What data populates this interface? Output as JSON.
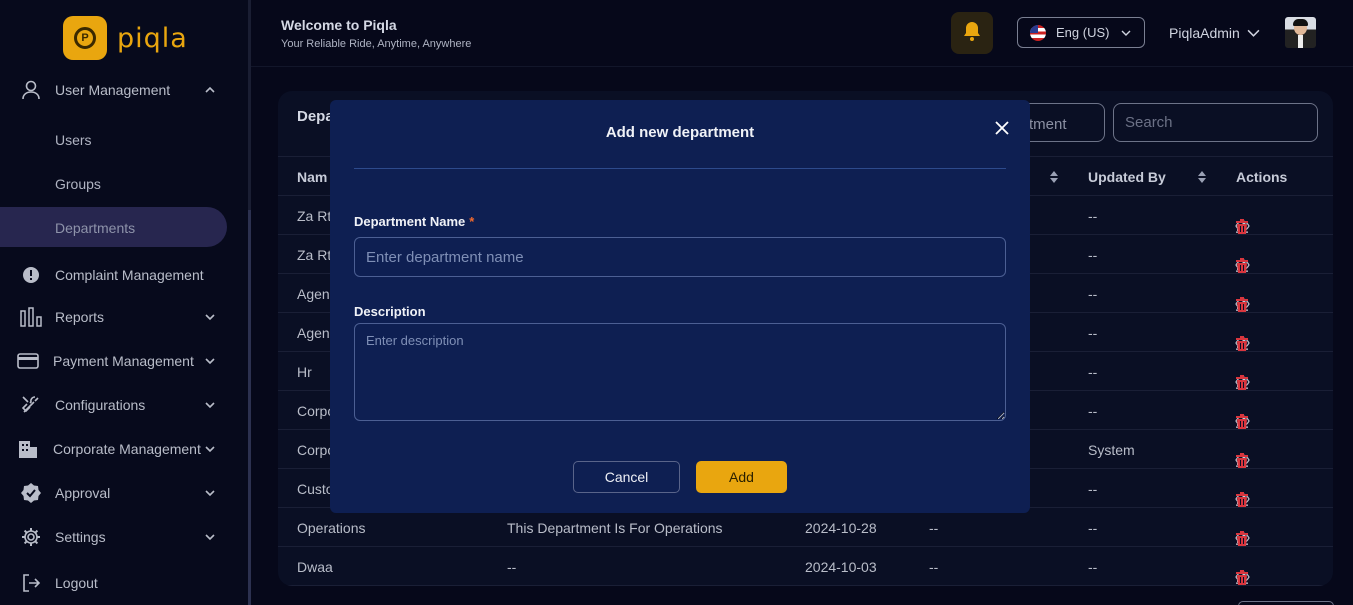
{
  "app": {
    "name": "piqla"
  },
  "sidebar": {
    "items": [
      {
        "label": "User Management",
        "icon": "user-icon"
      },
      {
        "label": "Complaint Management",
        "icon": "alert-circle-icon"
      },
      {
        "label": "Reports",
        "icon": "bar-chart-icon"
      },
      {
        "label": "Payment Management",
        "icon": "credit-card-icon"
      },
      {
        "label": "Configurations",
        "icon": "tools-icon"
      },
      {
        "label": "Corporate Management",
        "icon": "building-icon"
      },
      {
        "label": "Approval",
        "icon": "badge-check-icon"
      },
      {
        "label": "Settings",
        "icon": "gear-icon"
      },
      {
        "label": "Logout",
        "icon": "logout-icon"
      }
    ],
    "sub_items": [
      "Users",
      "Groups",
      "Departments"
    ]
  },
  "header": {
    "welcome": "Welcome to Piqla",
    "tagline": "Your Reliable Ride, Anytime, Anywhere",
    "language": "Eng (US)",
    "user": "PiqlaAdmin"
  },
  "card": {
    "title": "Depa",
    "add_button_partial": "tment",
    "search_placeholder": "Search",
    "columns": {
      "name": "Nam",
      "updated_by": "Updated By",
      "actions": "Actions"
    },
    "rows": [
      {
        "name": "Za Rt",
        "description": "",
        "created": "",
        "created_by": "",
        "updated_by": "--"
      },
      {
        "name": "Za Rt",
        "description": "",
        "created": "",
        "created_by": "",
        "updated_by": "--"
      },
      {
        "name": "Agen",
        "description": "",
        "created": "",
        "created_by": "",
        "updated_by": "--"
      },
      {
        "name": "Agen",
        "description": "",
        "created": "",
        "created_by": "",
        "updated_by": "--"
      },
      {
        "name": "Hr",
        "description": "",
        "created": "",
        "created_by": "",
        "updated_by": "--"
      },
      {
        "name": "Corpo",
        "description": "",
        "created": "",
        "created_by": "",
        "updated_by": "--"
      },
      {
        "name": "Corpo",
        "description": "",
        "created": "",
        "created_by": "",
        "updated_by": "System"
      },
      {
        "name": "Custo",
        "description": "",
        "created": "",
        "created_by": "",
        "updated_by": "--"
      },
      {
        "name": "Operations",
        "description": "This Department Is For Operations",
        "created": "2024-10-28",
        "created_by": "--",
        "updated_by": "--"
      },
      {
        "name": "Dwaa",
        "description": "--",
        "created": "2024-10-03",
        "created_by": "--",
        "updated_by": "--"
      }
    ]
  },
  "modal": {
    "title": "Add new department",
    "name_label": "Department Name",
    "required_mark": "*",
    "name_placeholder": "Enter department name",
    "description_label": "Description",
    "description_placeholder": "Enter description",
    "cancel_label": "Cancel",
    "add_label": "Add"
  },
  "colors": {
    "accent": "#e9a60f",
    "modal_bg": "#0e1f52",
    "danger": "#d9363e"
  }
}
